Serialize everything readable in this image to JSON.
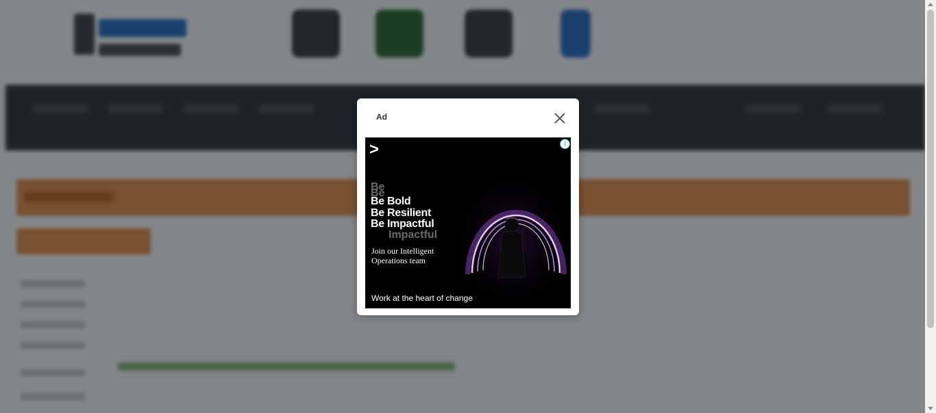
{
  "modal": {
    "title": "Ad",
    "close_icon": "close-icon"
  },
  "ad": {
    "info_glyph": "i",
    "logo_glyph": ">",
    "ghost_words": [
      "Be",
      "Be",
      "Impactful"
    ],
    "headline": [
      "Be Bold",
      "Be Resilient",
      "Be Impactful"
    ],
    "subtext": [
      "Join our Intelligent",
      "Operations team"
    ],
    "cta": "Work at the heart of change",
    "colors": {
      "background": "#000000",
      "accent": "#b06ad8",
      "info": "#00aecd"
    }
  },
  "background_page": {
    "nav_color": "#1f2428",
    "banner_color": "#e58a3e",
    "overlay": "rgba(30,34,40,0.55)"
  }
}
